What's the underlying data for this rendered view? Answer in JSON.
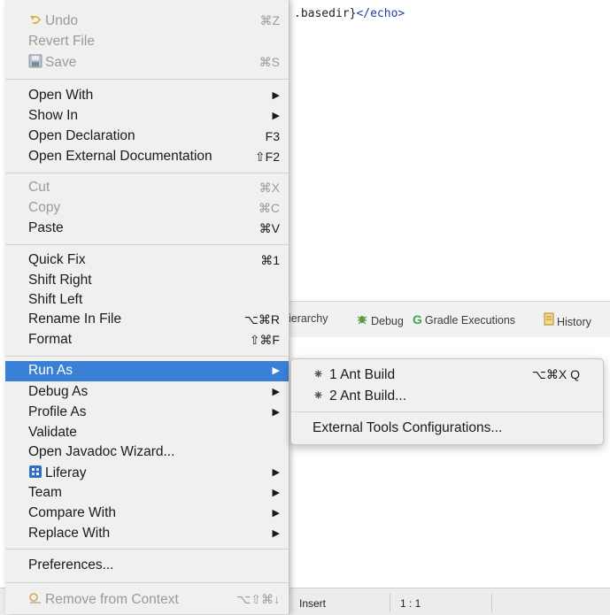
{
  "editor": {
    "code_text": ".basedir}",
    "code_tag": "</echo>"
  },
  "views_tabs": [
    {
      "label": "ierarchy",
      "icon": "hierarchy-icon"
    },
    {
      "label": "Debug",
      "icon": "debug-bug-icon"
    },
    {
      "label": "Gradle Executions",
      "icon": "gradle-icon"
    },
    {
      "label": "History",
      "icon": "history-icon"
    }
  ],
  "status_bar": {
    "insert_mode": "Insert",
    "cursor_position": "1 : 1"
  },
  "context_menu": {
    "undo": {
      "label": "Undo",
      "shortcut": "⌘Z",
      "icon": "undo-icon"
    },
    "revert_file": {
      "label": "Revert File"
    },
    "save": {
      "label": "Save",
      "shortcut": "⌘S",
      "icon": "save-disk-icon"
    },
    "open_with": {
      "label": "Open With"
    },
    "show_in": {
      "label": "Show In"
    },
    "open_declaration": {
      "label": "Open Declaration",
      "shortcut": "F3"
    },
    "open_external_doc": {
      "label": "Open External Documentation",
      "shortcut": "⇧F2"
    },
    "cut": {
      "label": "Cut",
      "shortcut": "⌘X"
    },
    "copy": {
      "label": "Copy",
      "shortcut": "⌘C"
    },
    "paste": {
      "label": "Paste",
      "shortcut": "⌘V"
    },
    "quick_fix": {
      "label": "Quick Fix",
      "shortcut": "⌘1"
    },
    "shift_right": {
      "label": "Shift Right"
    },
    "shift_left": {
      "label": "Shift Left"
    },
    "rename_in_file": {
      "label": "Rename In File",
      "shortcut": "⌥⌘R"
    },
    "format": {
      "label": "Format",
      "shortcut": "⇧⌘F"
    },
    "run_as": {
      "label": "Run As"
    },
    "debug_as": {
      "label": "Debug As"
    },
    "profile_as": {
      "label": "Profile As"
    },
    "validate": {
      "label": "Validate"
    },
    "open_javadoc_wizard": {
      "label": "Open Javadoc Wizard..."
    },
    "liferay": {
      "label": "Liferay",
      "icon": "liferay-icon"
    },
    "team": {
      "label": "Team"
    },
    "compare_with": {
      "label": "Compare With"
    },
    "replace_with": {
      "label": "Replace With"
    },
    "preferences": {
      "label": "Preferences..."
    },
    "remove_from_context": {
      "label": "Remove from Context",
      "shortcut": "⌥⇧⌘↓",
      "icon": "remove-context-icon"
    }
  },
  "run_as_submenu": {
    "ant_build_1": {
      "label": "1 Ant Build",
      "shortcut": "⌥⌘X Q",
      "icon": "ant-icon"
    },
    "ant_build_2": {
      "label": "2 Ant Build...",
      "icon": "ant-icon"
    },
    "external_tools": {
      "label": "External Tools Configurations..."
    }
  },
  "colors": {
    "selection": "#3a80d6",
    "menu_bg": "#f0f0f0",
    "disabled_text": "#9a9a9a"
  }
}
